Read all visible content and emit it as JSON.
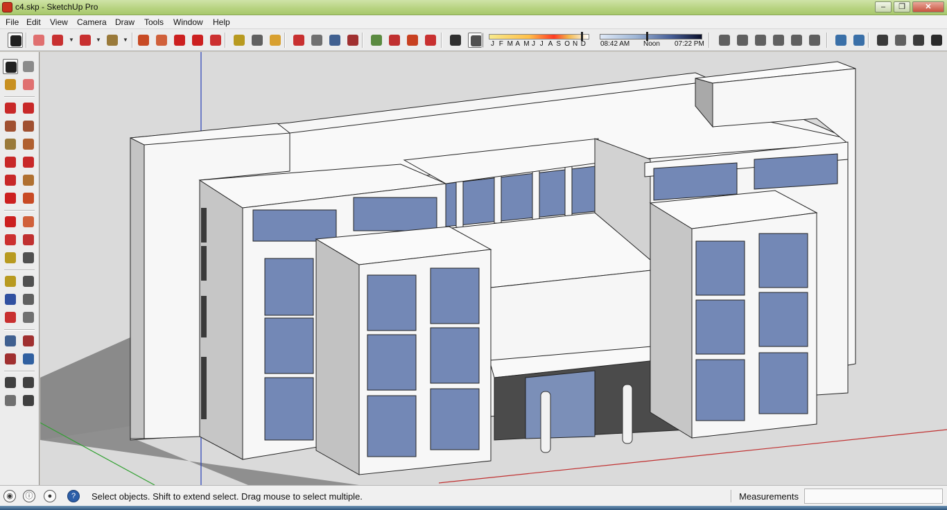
{
  "window": {
    "title": "c4.skp - SketchUp Pro",
    "minimize_symbol": "–",
    "maximize_symbol": "❐",
    "close_symbol": "✕"
  },
  "menu": {
    "items": [
      {
        "label": "File"
      },
      {
        "label": "Edit"
      },
      {
        "label": "View"
      },
      {
        "label": "Camera"
      },
      {
        "label": "Draw"
      },
      {
        "label": "Tools"
      },
      {
        "label": "Window"
      },
      {
        "label": "Help"
      }
    ]
  },
  "toolbar": {
    "tools": [
      {
        "icon": "select-arrow-icon",
        "color": "#202020"
      },
      {
        "icon": "eraser-icon",
        "color": "#e07070"
      },
      {
        "icon": "pencil-line-icon",
        "color": "#c83030"
      },
      {
        "icon": "arc-icon",
        "color": "#c83030"
      },
      {
        "icon": "circle-icon",
        "color": "#9a7a3a"
      },
      {
        "icon": "push-pull-icon",
        "color": "#c84a24"
      },
      {
        "icon": "follow-me-icon",
        "color": "#d0603a"
      },
      {
        "icon": "move-icon",
        "color": "#cc2020"
      },
      {
        "icon": "rotate-icon",
        "color": "#cc2020"
      },
      {
        "icon": "scale-icon",
        "color": "#cc3030"
      },
      {
        "icon": "tape-measure-icon",
        "color": "#b89a20"
      },
      {
        "icon": "text-icon",
        "color": "#606060"
      },
      {
        "icon": "paint-bucket-icon",
        "color": "#d8a030"
      },
      {
        "icon": "orbit-icon",
        "color": "#c83030"
      },
      {
        "icon": "pan-icon",
        "color": "#707070"
      },
      {
        "icon": "zoom-icon",
        "color": "#406090"
      },
      {
        "icon": "zoom-extents-icon",
        "color": "#a03030"
      },
      {
        "icon": "warehouse-icon",
        "color": "#5a8a40"
      },
      {
        "icon": "share-model-icon",
        "color": "#c03030"
      },
      {
        "icon": "components-icon",
        "color": "#c84020"
      },
      {
        "icon": "extension-icon",
        "color": "#c83030"
      },
      {
        "icon": "shadows-icon",
        "color": "#303030"
      },
      {
        "icon": "fog-icon",
        "color": "#505050"
      },
      {
        "icon": "iso-view-icon",
        "color": "#606060"
      },
      {
        "icon": "top-view-icon",
        "color": "#606060"
      },
      {
        "icon": "front-view-icon",
        "color": "#606060"
      },
      {
        "icon": "right-view-icon",
        "color": "#606060"
      },
      {
        "icon": "back-view-icon",
        "color": "#606060"
      },
      {
        "icon": "left-view-icon",
        "color": "#606060"
      },
      {
        "icon": "xray-icon",
        "color": "#3a70a8"
      },
      {
        "icon": "back-edges-icon",
        "color": "#3a70a8"
      },
      {
        "icon": "wireframe-icon",
        "color": "#3a3a3a"
      },
      {
        "icon": "hidden-line-icon",
        "color": "#606060"
      },
      {
        "icon": "shaded-icon",
        "color": "#3a3a3a"
      },
      {
        "icon": "shaded-textures-icon",
        "color": "#2a2a2a"
      }
    ],
    "months": [
      "J",
      "F",
      "M",
      "A",
      "M",
      "J",
      "J",
      "A",
      "S",
      "O",
      "N",
      "D"
    ],
    "time_start": "08:42 AM",
    "time_mid": "Noon",
    "time_end": "07:22 PM"
  },
  "left_tools": [
    {
      "icon": "select-arrow-icon",
      "color": "#202020"
    },
    {
      "icon": "make-component-icon",
      "color": "#8a8a8a"
    },
    {
      "icon": "paint-bucket-icon",
      "color": "#c89020"
    },
    {
      "icon": "eraser-icon",
      "color": "#e07070"
    },
    {
      "icon": "line-icon",
      "color": "#c82828"
    },
    {
      "icon": "freehand-icon",
      "color": "#c82828"
    },
    {
      "icon": "rectangle-icon",
      "color": "#a05030"
    },
    {
      "icon": "rotated-rectangle-icon",
      "color": "#a05030"
    },
    {
      "icon": "circle-icon",
      "color": "#9a7a3a"
    },
    {
      "icon": "polygon-icon",
      "color": "#b06030"
    },
    {
      "icon": "arc-icon",
      "color": "#c82828"
    },
    {
      "icon": "two-point-arc-icon",
      "color": "#c82828"
    },
    {
      "icon": "three-point-arc-icon",
      "color": "#c82828"
    },
    {
      "icon": "pie-icon",
      "color": "#b07030"
    },
    {
      "icon": "move-icon",
      "color": "#cc2020"
    },
    {
      "icon": "push-pull-icon",
      "color": "#c84a24"
    },
    {
      "icon": "rotate-icon",
      "color": "#cc2020"
    },
    {
      "icon": "follow-me-icon",
      "color": "#d0603a"
    },
    {
      "icon": "scale-icon",
      "color": "#cc3030"
    },
    {
      "icon": "offset-icon",
      "color": "#c03030"
    },
    {
      "icon": "tape-measure-icon",
      "color": "#b89a20"
    },
    {
      "icon": "dimension-icon",
      "color": "#505050"
    },
    {
      "icon": "protractor-icon",
      "color": "#b89a20"
    },
    {
      "icon": "text-icon",
      "color": "#505050"
    },
    {
      "icon": "axes-icon",
      "color": "#3050a0"
    },
    {
      "icon": "3d-text-icon",
      "color": "#606060"
    },
    {
      "icon": "orbit-icon",
      "color": "#c83030"
    },
    {
      "icon": "pan-icon",
      "color": "#707070"
    },
    {
      "icon": "zoom-icon",
      "color": "#406090"
    },
    {
      "icon": "zoom-window-icon",
      "color": "#a03030"
    },
    {
      "icon": "zoom-extents-icon",
      "color": "#a03030"
    },
    {
      "icon": "previous-view-icon",
      "color": "#3060a0"
    },
    {
      "icon": "position-camera-icon",
      "color": "#404040"
    },
    {
      "icon": "look-around-icon",
      "color": "#404040"
    },
    {
      "icon": "walk-icon",
      "color": "#707070"
    },
    {
      "icon": "section-plane-icon",
      "color": "#404040"
    }
  ],
  "viewport": {
    "background_color": "#dadada",
    "wall_color": "#f7f7f7",
    "side_wall_color": "#c4c4c4",
    "shadow_color": "#8f8f8f",
    "glass_color": "#7388b6",
    "axis_blue": "#2840b8",
    "axis_red": "#c03030",
    "axis_green": "#30a030"
  },
  "status": {
    "geo_icon": "geolocation-icon",
    "credits_icon": "credits-icon",
    "user_icon": "user-icon",
    "help_icon": "help-icon",
    "message": "Select objects. Shift to extend select. Drag mouse to select multiple.",
    "measurements_label": "Measurements",
    "measurements_value": ""
  }
}
